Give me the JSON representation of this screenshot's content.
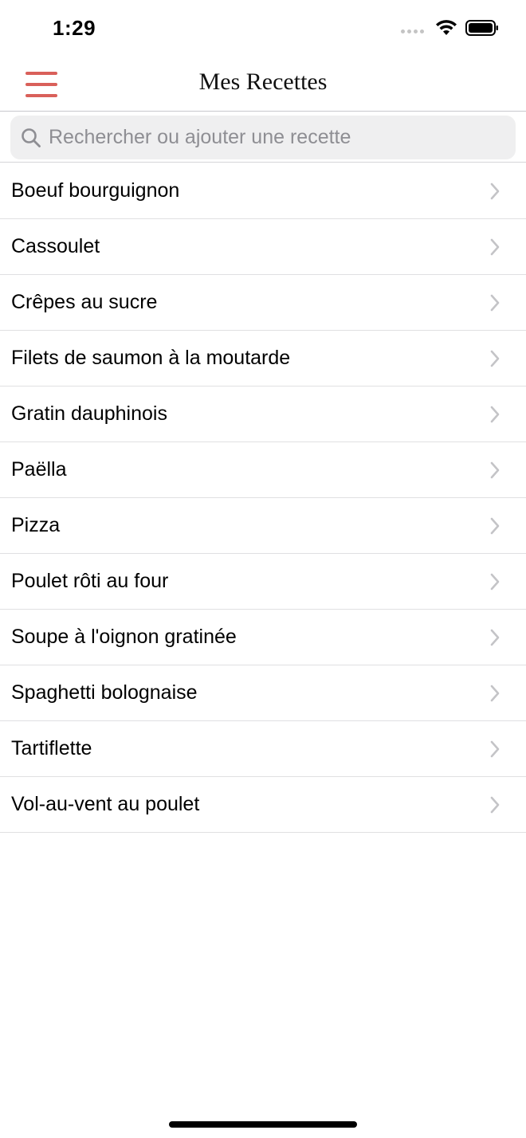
{
  "status_bar": {
    "time": "1:29"
  },
  "nav": {
    "title": "Mes Recettes",
    "menu_icon": "hamburger-menu-icon",
    "accent_color": "#d9605a"
  },
  "search": {
    "placeholder": "Rechercher ou ajouter une recette",
    "value": ""
  },
  "recipes": [
    "Boeuf bourguignon",
    "Cassoulet",
    "Crêpes au sucre",
    "Filets de saumon à la moutarde",
    "Gratin dauphinois",
    "Paëlla",
    "Pizza",
    "Poulet rôti au four",
    "Soupe à l'oignon gratinée",
    "Spaghetti bolognaise",
    "Tartiflette",
    "Vol-au-vent au poulet"
  ]
}
